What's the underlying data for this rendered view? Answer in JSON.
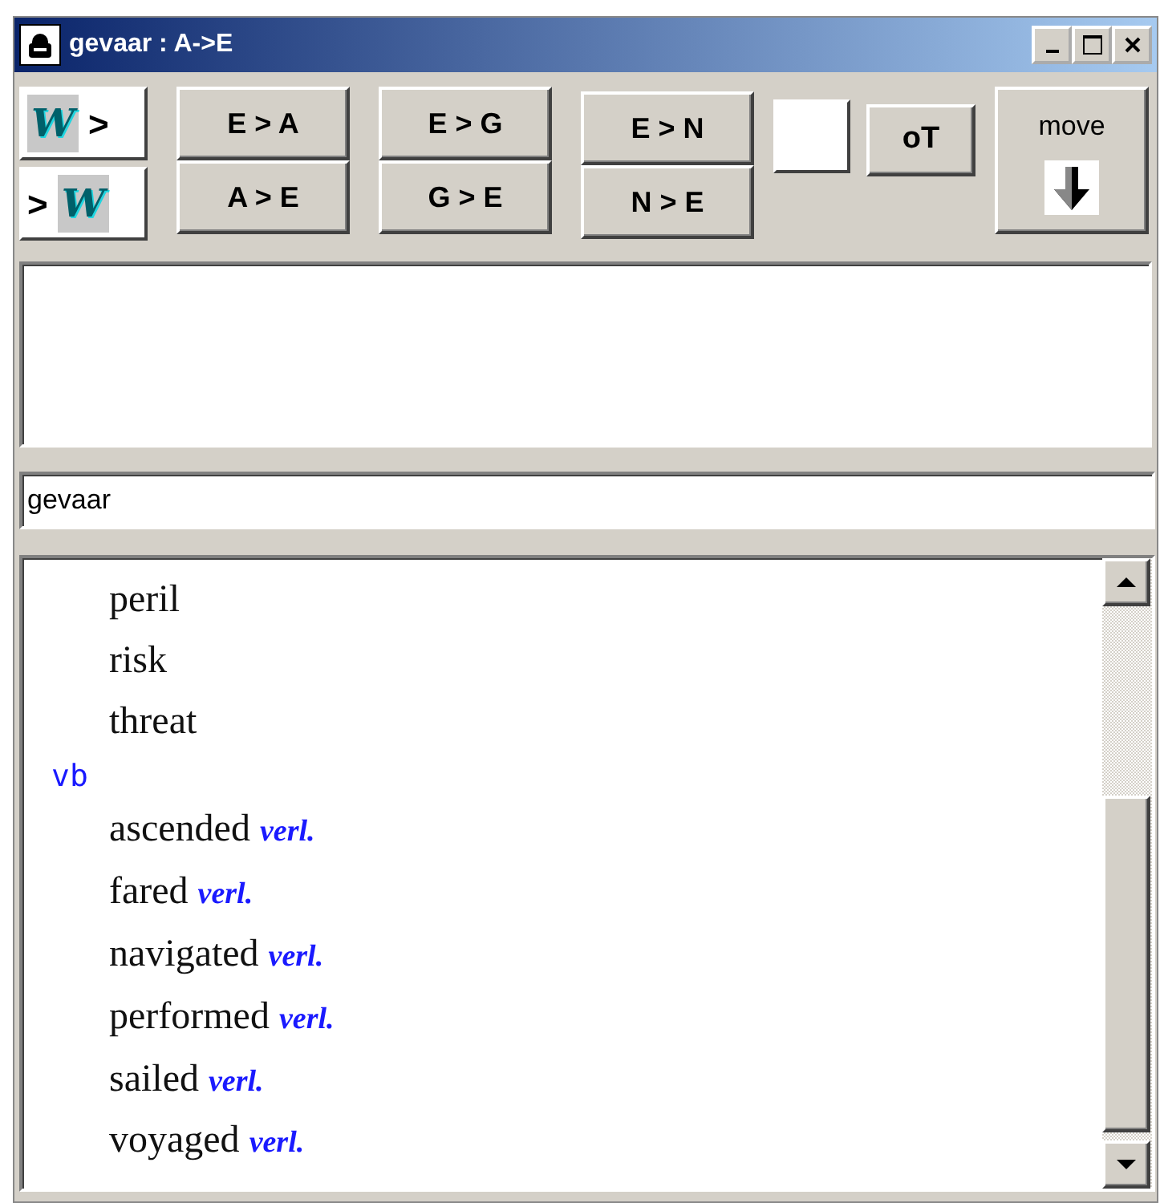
{
  "window": {
    "title": "gevaar : A->E"
  },
  "direction_buttons": [
    {
      "kind": "w-first",
      "letter": "W",
      "arrow": ">"
    },
    {
      "kind": "w-last",
      "letter": "W",
      "arrow": ">"
    }
  ],
  "pair_buttons": [
    {
      "top": "E > A",
      "bottom": "A > E"
    },
    {
      "top": "E > G",
      "bottom": "G > E"
    },
    {
      "top": "E > N",
      "bottom": "N > E"
    }
  ],
  "ot_button": "oT",
  "move_button": {
    "label": "move"
  },
  "search": {
    "value": "gevaar"
  },
  "results": [
    {
      "kind": "term",
      "text": "peril"
    },
    {
      "kind": "term",
      "text": "risk"
    },
    {
      "kind": "term",
      "text": "threat"
    },
    {
      "kind": "pos",
      "text": "vb"
    },
    {
      "kind": "term",
      "text": "ascended",
      "tag": "verl."
    },
    {
      "kind": "term",
      "text": "fared",
      "tag": "verl."
    },
    {
      "kind": "term",
      "text": "navigated",
      "tag": "verl."
    },
    {
      "kind": "term",
      "text": "performed",
      "tag": "verl."
    },
    {
      "kind": "term",
      "text": "sailed",
      "tag": "verl."
    },
    {
      "kind": "term",
      "text": "voyaged",
      "tag": "verl."
    }
  ]
}
